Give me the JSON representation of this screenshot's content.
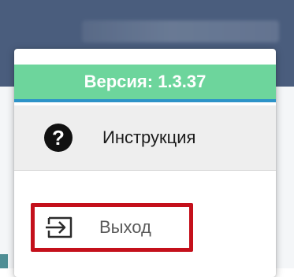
{
  "version_label": "Версия: 1.3.37",
  "menu": {
    "instructions_label": "Инструкция",
    "logout_label": "Выход"
  },
  "icons": {
    "instructions": "help-circle-icon",
    "logout": "logout-icon"
  },
  "colors": {
    "topbar": "#4a5d7d",
    "version_bar": "#6dd59c",
    "version_underline": "#2d93c8",
    "highlight_border": "#c4101b"
  }
}
